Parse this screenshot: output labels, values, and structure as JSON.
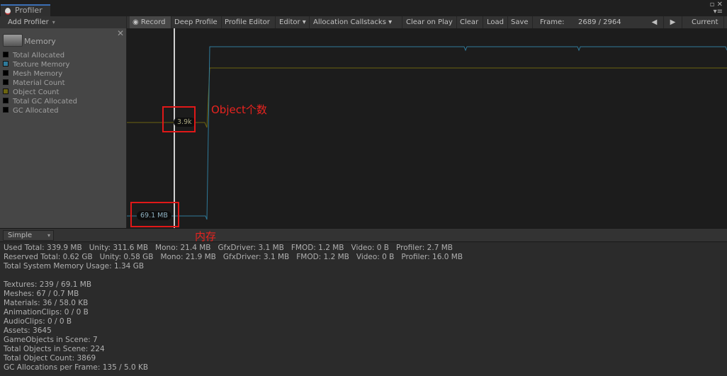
{
  "window": {
    "tab_label": "Profiler"
  },
  "toolbar": {
    "add_profiler": "Add Profiler",
    "record": "Record",
    "deep_profile": "Deep Profile",
    "profile_editor": "Profile Editor",
    "editor": "Editor",
    "allocation_callstacks": "Allocation Callstacks",
    "clear_on_play": "Clear on Play",
    "clear": "Clear",
    "load": "Load",
    "save": "Save",
    "frame_label": "Frame:",
    "frame_value": "2689 / 2964",
    "current": "Current"
  },
  "memory_panel": {
    "title": "Memory",
    "legend": [
      {
        "label": "Total Allocated",
        "color": "#000000"
      },
      {
        "label": "Texture Memory",
        "color": "#2f7a9a"
      },
      {
        "label": "Mesh Memory",
        "color": "#000000"
      },
      {
        "label": "Material Count",
        "color": "#000000"
      },
      {
        "label": "Object Count",
        "color": "#6b6410"
      },
      {
        "label": "Total GC Allocated",
        "color": "#000000"
      },
      {
        "label": "GC Allocated",
        "color": "#000000"
      }
    ]
  },
  "chart": {
    "object_count_label": "3.9k",
    "texture_memory_label": "69.1 MB",
    "colors": {
      "texture": "#2f7a9a",
      "object": "#6b6410"
    }
  },
  "annotations": {
    "object_count": "Object个数",
    "memory": "内存"
  },
  "view_mode": "Simple",
  "details": [
    "Used Total: 339.9 MB   Unity: 311.6 MB   Mono: 21.4 MB   GfxDriver: 3.1 MB   FMOD: 1.2 MB   Video: 0 B   Profiler: 2.7 MB",
    "Reserved Total: 0.62 GB   Unity: 0.58 GB   Mono: 21.9 MB   GfxDriver: 3.1 MB   FMOD: 1.2 MB   Video: 0 B   Profiler: 16.0 MB",
    "Total System Memory Usage: 1.34 GB",
    "",
    "Textures: 239 / 69.1 MB",
    "Meshes: 67 / 0.7 MB",
    "Materials: 36 / 58.0 KB",
    "AnimationClips: 0 / 0 B",
    "AudioClips: 0 / 0 B",
    "Assets: 3645",
    "GameObjects in Scene: 7",
    "Total Objects in Scene: 224",
    "Total Object Count: 3869",
    "GC Allocations per Frame: 135 / 5.0 KB"
  ]
}
